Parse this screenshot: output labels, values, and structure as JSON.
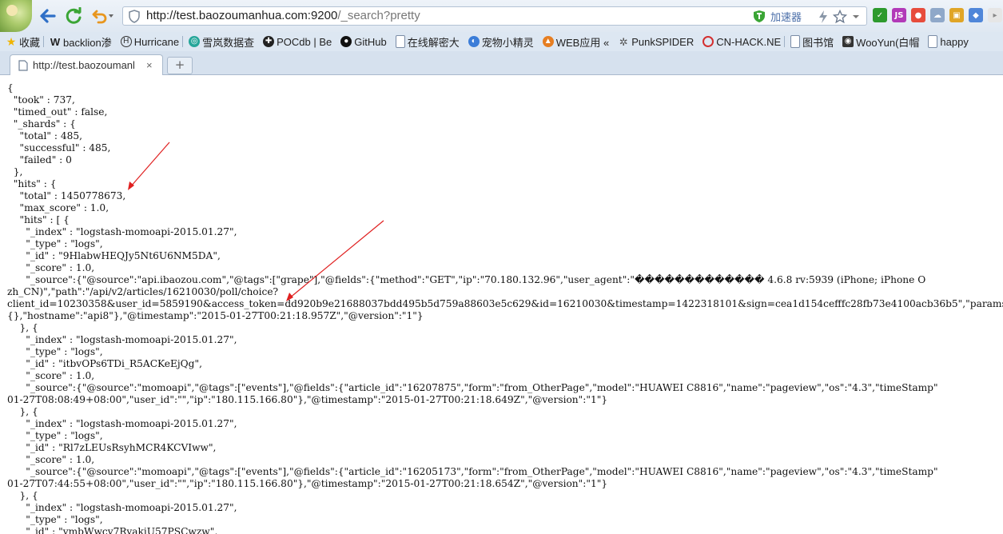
{
  "browser": {
    "url_host": "http://test.baozoumanhua.com:9200",
    "url_path": "/_search?pretty",
    "accelerator_label": "加速器",
    "colors": {
      "accent_green": "#3aa535",
      "arrow_red": "#e02020",
      "link_blue": "#2e6fc7"
    }
  },
  "bookmarks": [
    {
      "label": "收藏",
      "icon": "star-icon"
    },
    {
      "label": "backlion渗",
      "icon": "w-logo-icon"
    },
    {
      "label": "Hurricane",
      "icon": "hurricane-icon"
    },
    {
      "label": "雪岚数据查",
      "icon": "globe-icon"
    },
    {
      "label": "POCdb | Be",
      "icon": "pocdb-icon"
    },
    {
      "label": "GitHub",
      "icon": "github-icon"
    },
    {
      "label": "在线解密大",
      "icon": "page-icon"
    },
    {
      "label": "宠物小精灵",
      "icon": "pet-icon"
    },
    {
      "label": "WEB应用 «",
      "icon": "fox-icon"
    },
    {
      "label": "PunkSPIDER",
      "icon": "spider-icon"
    },
    {
      "label": "CN-HACK.NE",
      "icon": "cnhack-icon"
    },
    {
      "label": "图书馆",
      "icon": "page-icon"
    },
    {
      "label": "WooYun(白帽",
      "icon": "wooyun-icon"
    },
    {
      "label": "happy",
      "icon": "page-icon"
    }
  ],
  "tabs": [
    {
      "title": "http://test.baozoumanl",
      "close": "×"
    }
  ],
  "new_tab_label": "+",
  "json_lines": [
    "{",
    "  \"took\" : 737,",
    "  \"timed_out\" : false,",
    "  \"_shards\" : {",
    "    \"total\" : 485,",
    "    \"successful\" : 485,",
    "    \"failed\" : 0",
    "  },",
    "  \"hits\" : {",
    "    \"total\" : 1450778673,",
    "    \"max_score\" : 1.0,",
    "    \"hits\" : [ {",
    "      \"_index\" : \"logstash-momoapi-2015.01.27\",",
    "      \"_type\" : \"logs\",",
    "      \"_id\" : \"9HlabwHEQJy5Nt6U6NM5DA\",",
    "      \"_score\" : 1.0,",
    "      \"_source\":{\"@source\":\"api.ibaozou.com\",\"@tags\":[\"grape\"],\"@fields\":{\"method\":\"GET\",\"ip\":\"70.180.132.96\",\"user_agent\":\"������������� 4.6.8 rv:5939 (iPhone; iPhone O",
    "zh_CN)\",\"path\":\"/api/v2/articles/16210030/poll/choice?",
    "client_id=10230358&user_id=5859190&access_token=dd920b9e21688037bdd495b5d759a88603e5c629&id=16210030&timestamp=1422318101&sign=cea1d154cefffc28fb73e4100acb36b5\",\"params\":",
    "{},\"hostname\":\"api8\"},\"@timestamp\":\"2015-01-27T00:21:18.957Z\",\"@version\":\"1\"}",
    "    }, {",
    "      \"_index\" : \"logstash-momoapi-2015.01.27\",",
    "      \"_type\" : \"logs\",",
    "      \"_id\" : \"itbvOPs6TDi_R5ACKeEjQg\",",
    "      \"_score\" : 1.0,",
    "      \"_source\":{\"@source\":\"momoapi\",\"@tags\":[\"events\"],\"@fields\":{\"article_id\":\"16207875\",\"form\":\"from_OtherPage\",\"model\":\"HUAWEI C8816\",\"name\":\"pageview\",\"os\":\"4.3\",\"timeStamp\"",
    "01-27T08:08:49+08:00\",\"user_id\":\"\",\"ip\":\"180.115.166.80\"},\"@timestamp\":\"2015-01-27T00:21:18.649Z\",\"@version\":\"1\"}",
    "    }, {",
    "      \"_index\" : \"logstash-momoapi-2015.01.27\",",
    "      \"_type\" : \"logs\",",
    "      \"_id\" : \"Rl7zLEUsRsyhMCR4KCVIww\",",
    "      \"_score\" : 1.0,",
    "      \"_source\":{\"@source\":\"momoapi\",\"@tags\":[\"events\"],\"@fields\":{\"article_id\":\"16205173\",\"form\":\"from_OtherPage\",\"model\":\"HUAWEI C8816\",\"name\":\"pageview\",\"os\":\"4.3\",\"timeStamp\"",
    "01-27T07:44:55+08:00\",\"user_id\":\"\",\"ip\":\"180.115.166.80\"},\"@timestamp\":\"2015-01-27T00:21:18.654Z\",\"@version\":\"1\"}",
    "    }, {",
    "      \"_index\" : \"logstash-momoapi-2015.01.27\",",
    "      \"_type\" : \"logs\",",
    "      \"_id\" : \"ymbWwcv7RyakiU57PSCwzw\","
  ]
}
